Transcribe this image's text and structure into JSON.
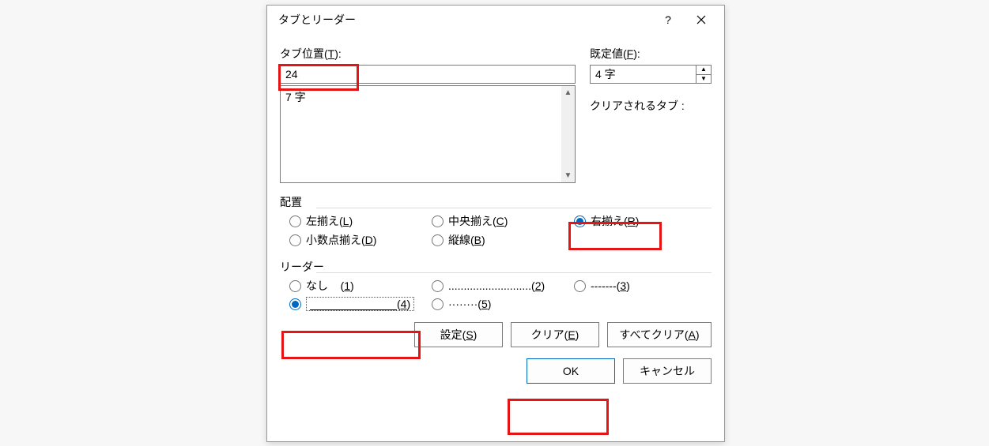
{
  "dialog": {
    "title": "タブとリーダー",
    "help_label": "?",
    "tab_position": {
      "label_pre": "タブ位置(",
      "label_mn": "T",
      "label_post": "):",
      "value": "24",
      "list_item": "7 字"
    },
    "default": {
      "label_pre": "既定値(",
      "label_mn": "F",
      "label_post": "):",
      "value": "4 字"
    },
    "cleared_tabs_label": "クリアされるタブ :",
    "alignment": {
      "group_label": "配置",
      "left": {
        "pre": "左揃え(",
        "mn": "L",
        "post": ")"
      },
      "center": {
        "pre": "中央揃え(",
        "mn": "C",
        "post": ")"
      },
      "right": {
        "pre": "右揃え(",
        "mn": "R",
        "post": ")"
      },
      "decimal": {
        "pre": "小数点揃え(",
        "mn": "D",
        "post": ")"
      },
      "bar": {
        "pre": "縦線(",
        "mn": "B",
        "post": ")"
      }
    },
    "leader": {
      "group_label": "リーダー",
      "none": {
        "text": "なし",
        "num_pre": "(",
        "mn": "1",
        "num_post": ")"
      },
      "opt2": {
        "text": "...........................",
        "num_pre": "(",
        "mn": "2",
        "num_post": ")"
      },
      "opt3": {
        "text": "-------",
        "num_pre": "(",
        "mn": "3",
        "num_post": ")"
      },
      "opt4": {
        "num_pre": "(",
        "mn": "4",
        "num_post": ")"
      },
      "opt5": {
        "text": "········",
        "num_pre": "(",
        "mn": "5",
        "num_post": ")"
      }
    },
    "buttons": {
      "set": {
        "pre": "設定(",
        "mn": "S",
        "post": ")"
      },
      "clear": {
        "pre": "クリア(",
        "mn": "E",
        "post": ")"
      },
      "clearall": {
        "pre": "すべてクリア(",
        "mn": "A",
        "post": ")"
      },
      "ok": "OK",
      "cancel": "キャンセル"
    }
  }
}
